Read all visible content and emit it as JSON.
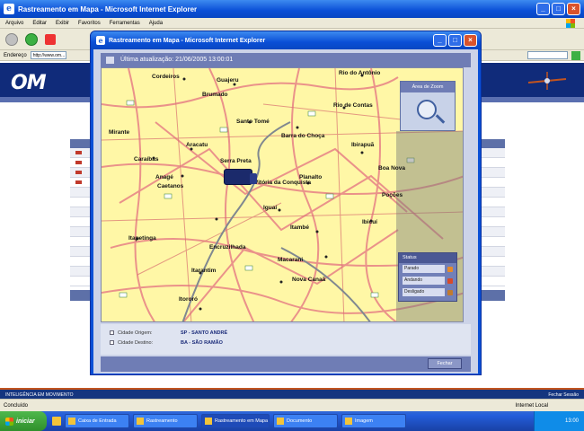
{
  "background_window": {
    "title": "Rastreamento em Mapa - Microsoft Internet Explorer",
    "menu": [
      "Arquivo",
      "Editar",
      "Exibir",
      "Favoritos",
      "Ferramentas",
      "Ajuda"
    ],
    "address_label": "Endereço",
    "address_value": "http://www.om...",
    "logo_text": "OM",
    "footer_left": "INTELIGÊNCIA EM MOVIMENTO",
    "footer_right": "Fechar Sessão",
    "status_left": "Concluído",
    "status_zone": "Internet Local"
  },
  "popup": {
    "title": "Rastreamento em Mapa - Microsoft Internet Explorer",
    "map_header": "Última atualização: 21/06/2005 13:00:01",
    "zoom_title": "Área de Zoom",
    "legend_title": "Status",
    "legend": [
      {
        "label": "Parado",
        "color": "#e58a2a"
      },
      {
        "label": "Andando",
        "color": "#d84a2a"
      },
      {
        "label": "Desligado",
        "color": "#c07a30"
      }
    ],
    "info": [
      {
        "label": "Cidade Origem:",
        "value": "SP - SANTO ANDRÉ"
      },
      {
        "label": "Cidade Destino:",
        "value": "BA - SÃO RAMÃO"
      }
    ],
    "close_label": "Fechar"
  },
  "map": {
    "labels": [
      {
        "text": "Cordeiros"
      },
      {
        "text": "Guajeru"
      },
      {
        "text": "Rio do Antônio"
      },
      {
        "text": "Brumado"
      },
      {
        "text": "Santo Tomé"
      },
      {
        "text": "Rio de Contas"
      },
      {
        "text": "Mirante"
      },
      {
        "text": "Aracatu"
      },
      {
        "text": "Barra do Choça"
      },
      {
        "text": "Ibirapuã"
      },
      {
        "text": "Caraíbas"
      },
      {
        "text": "Serra Preta"
      },
      {
        "text": "Boa Nova"
      },
      {
        "text": "Anagé"
      },
      {
        "text": "Caetanos"
      },
      {
        "text": "Vitória da Conquista"
      },
      {
        "text": "Planalto"
      },
      {
        "text": "Poções"
      },
      {
        "text": "Iguaí"
      },
      {
        "text": "Ibicuí"
      },
      {
        "text": "Itambé"
      },
      {
        "text": "Itapetinga"
      },
      {
        "text": "Encruzilhada"
      },
      {
        "text": "Macarani"
      },
      {
        "text": "Itarantim"
      },
      {
        "text": "Nova Canaã"
      },
      {
        "text": "Itororó"
      }
    ]
  },
  "taskbar": {
    "start": "iniciar",
    "items": [
      "Caixa de Entrada",
      "Rastreamento",
      "Rastreamento em Mapa",
      "Documento",
      "Imagem"
    ],
    "clock": "13:00"
  }
}
